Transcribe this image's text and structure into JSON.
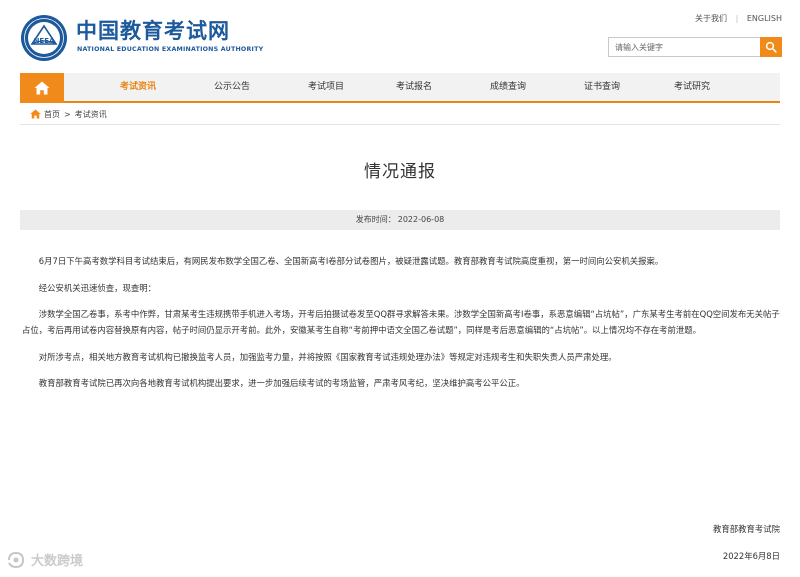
{
  "header": {
    "site_name_cn": "中国教育考试网",
    "site_name_en": "NATIONAL EDUCATION EXAMINATIONS AUTHORITY",
    "emblem_text": "NEEA",
    "top_links": {
      "about": "关于我们",
      "english": "ENGLISH"
    },
    "search": {
      "placeholder": "请输入关键字"
    }
  },
  "nav": {
    "items": [
      {
        "label": "考试资讯",
        "active": true
      },
      {
        "label": "公示公告",
        "active": false
      },
      {
        "label": "考试项目",
        "active": false
      },
      {
        "label": "考试报名",
        "active": false
      },
      {
        "label": "成绩查询",
        "active": false
      },
      {
        "label": "证书查询",
        "active": false
      },
      {
        "label": "考试研究",
        "active": false
      }
    ]
  },
  "breadcrumb": {
    "home": "首页",
    "separator": ">",
    "current": "考试资讯"
  },
  "article": {
    "title": "情况通报",
    "publish_label": "发布时间：",
    "publish_date": "2022-06-08",
    "paragraphs": [
      "6月7日下午高考数学科目考试结束后，有网民发布数学全国乙卷、全国新高考I卷部分试卷图片，被疑泄露试题。教育部教育考试院高度重视，第一时间向公安机关报案。",
      "经公安机关迅速侦查，现查明：",
      "涉数学全国乙卷事，系考中作弊，甘肃某考生违规携带手机进入考场，开考后拍摄试卷发至QQ群寻求解答未果。涉数学全国新高考I卷事，系恶意编辑“占坑帖”，广东某考生考前在QQ空间发布无关帖子占位，考后再用试卷内容替换原有内容，帖子时间仍显示开考前。此外，安徽某考生自称“考前押中语文全国乙卷试题”，同样是考后恶意编辑的“占坑帖”。以上情况均不存在考前泄题。",
      "对所涉考点，相关地方教育考试机构已撤换监考人员，加强监考力量，并将按照《国家教育考试违规处理办法》等规定对违规考生和失职失责人员严肃处理。",
      "教育部教育考试院已再次向各地教育考试机构提出要求，进一步加强后续考试的考场监管，严肃考风考纪，坚决维护高考公平公正。"
    ],
    "signature": "教育部教育考试院",
    "date": "2022年6月8日"
  },
  "watermark": {
    "text": "大数跨境"
  },
  "colors": {
    "brand_blue": "#1d5a9c",
    "accent_orange": "#f08a1a",
    "nav_bg": "#f2f2f2",
    "meta_bg": "#ececec"
  },
  "icons": {
    "home": "home-icon",
    "search": "search-icon",
    "breadcrumb_home": "home-icon",
    "emblem": "neea-emblem-icon"
  }
}
